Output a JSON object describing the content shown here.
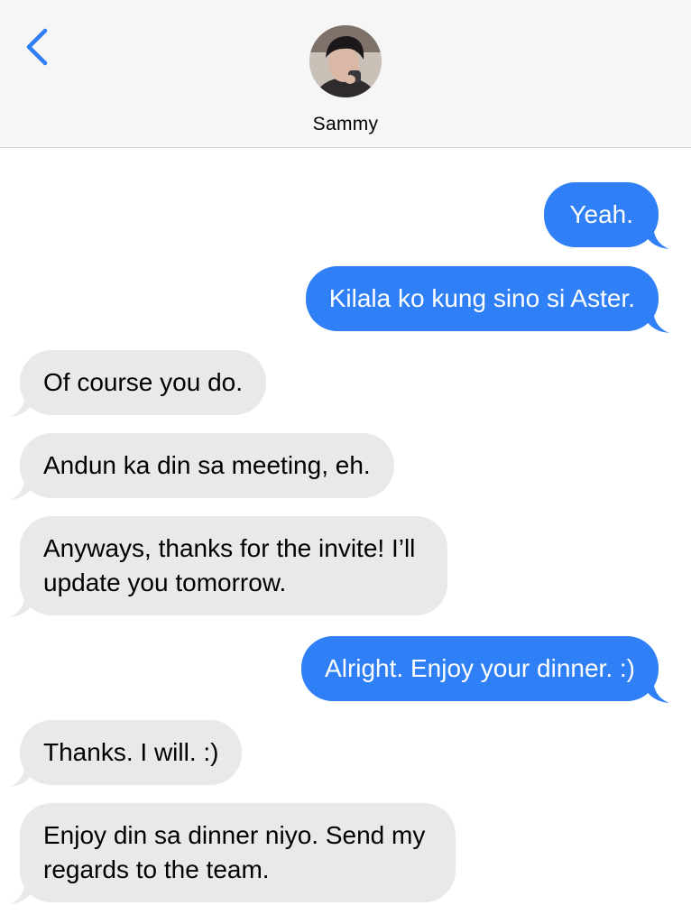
{
  "header": {
    "contact_name": "Sammy",
    "back_icon": "chevron-left-icon",
    "avatar": "contact-avatar-photo"
  },
  "colors": {
    "sent_bubble": "#2f7ff6",
    "received_bubble": "#e9e9ec",
    "accent": "#2f7ff6",
    "header_bg": "#f6f6f6"
  },
  "messages": [
    {
      "direction": "sent",
      "text": "Yeah."
    },
    {
      "direction": "sent",
      "text": "Kilala ko kung sino si Aster."
    },
    {
      "direction": "received",
      "text": "Of course you do."
    },
    {
      "direction": "received",
      "text": "Andun ka din sa meeting, eh."
    },
    {
      "direction": "received",
      "lines": [
        "Anyways, thanks for the invite! I’ll",
        "update you tomorrow."
      ]
    },
    {
      "direction": "sent",
      "text": "Alright. Enjoy your dinner. :)"
    },
    {
      "direction": "received",
      "text": "Thanks. I will. :)"
    },
    {
      "direction": "received",
      "lines": [
        "Enjoy din sa dinner niyo. Send my",
        "regards to the team."
      ]
    }
  ]
}
